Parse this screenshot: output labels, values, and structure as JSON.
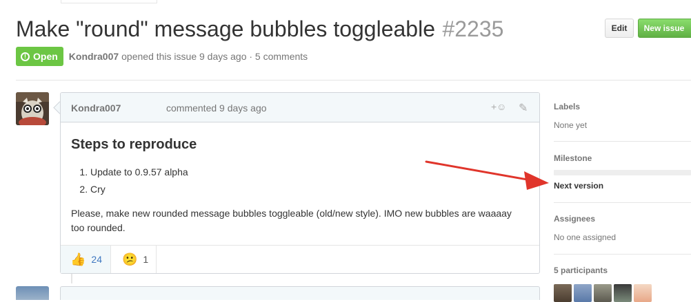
{
  "issue": {
    "title": "Make \"round\" message bubbles toggleable",
    "number": "#2235",
    "status": "Open",
    "author": "Kondra007",
    "meta": "opened this issue 9 days ago · 5 comments"
  },
  "header_buttons": {
    "edit_label": "Edit",
    "new_issue_label": "New issue"
  },
  "comment": {
    "author": "Kondra007",
    "meta": "commented 9 days ago",
    "add_reaction": "+☺",
    "heading": "Steps to reproduce",
    "steps": [
      "Update to 0.9.57 alpha",
      "Cry"
    ],
    "body": "Please, make new rounded message bubbles toggleable (old/new style). IMO new bubbles are waaaay too rounded.",
    "reactions": [
      {
        "emoji": "👍",
        "count": "24"
      },
      {
        "emoji": "😕",
        "count": "1"
      }
    ]
  },
  "sidebar": {
    "labels": {
      "heading": "Labels",
      "value": "None yet"
    },
    "milestone": {
      "heading": "Milestone",
      "name": "Next version",
      "progress": 0
    },
    "assignees": {
      "heading": "Assignees",
      "value": "No one assigned"
    },
    "participants": {
      "heading": "5 participants"
    }
  },
  "colors": {
    "open_green": "#6cc644",
    "arrow_red": "#e0352b",
    "link_blue": "#4078c0"
  }
}
